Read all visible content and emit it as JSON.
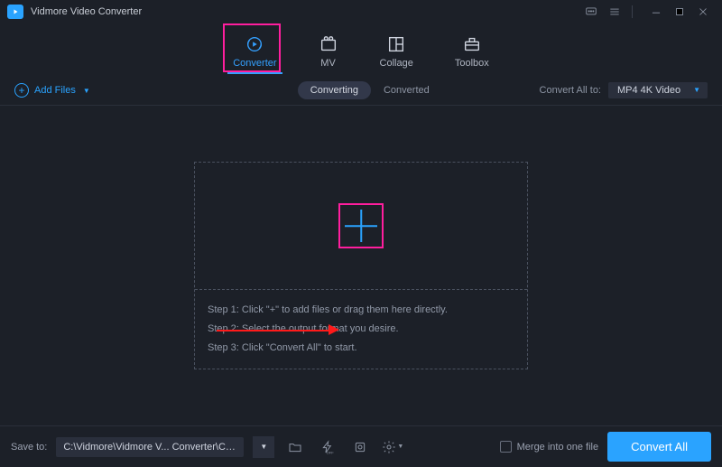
{
  "title": "Vidmore Video Converter",
  "mainnav": {
    "items": [
      {
        "label": "Converter"
      },
      {
        "label": "MV"
      },
      {
        "label": "Collage"
      },
      {
        "label": "Toolbox"
      }
    ]
  },
  "subbar": {
    "add_files_label": "Add Files",
    "tab_converting": "Converting",
    "tab_converted": "Converted",
    "convert_all_to_label": "Convert All to:",
    "selected_format": "MP4 4K Video"
  },
  "steps": {
    "s1": "Step 1: Click \"+\" to add files or drag them here directly.",
    "s2": "Step 2: Select the output format you desire.",
    "s3": "Step 3: Click \"Convert All\" to start."
  },
  "bottom": {
    "save_to_label": "Save to:",
    "save_path": "C:\\Vidmore\\Vidmore V... Converter\\Converted",
    "merge_label": "Merge into one file",
    "convert_all_button": "Convert All"
  }
}
